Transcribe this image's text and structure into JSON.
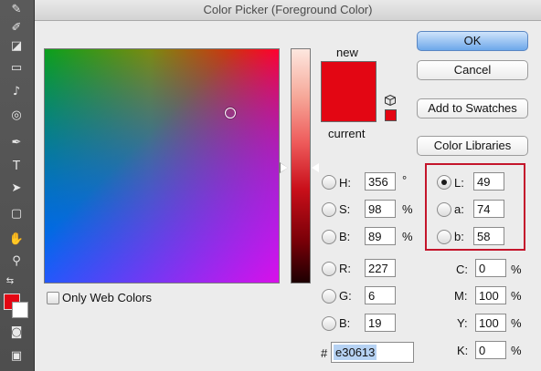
{
  "window": {
    "title": "Color Picker (Foreground Color)"
  },
  "buttons": {
    "ok": "OK",
    "cancel": "Cancel",
    "add_to_swatches": "Add to Swatches",
    "color_libraries": "Color Libraries"
  },
  "preview": {
    "new_label": "new",
    "current_label": "current",
    "new_color": "#e30613",
    "current_color": "#e30613"
  },
  "hsb": {
    "h": {
      "label": "H:",
      "value": "356",
      "unit": "°"
    },
    "s": {
      "label": "S:",
      "value": "98",
      "unit": "%"
    },
    "b": {
      "label": "B:",
      "value": "89",
      "unit": "%"
    }
  },
  "rgb": {
    "r": {
      "label": "R:",
      "value": "227"
    },
    "g": {
      "label": "G:",
      "value": "6"
    },
    "b": {
      "label": "B:",
      "value": "19"
    }
  },
  "lab": {
    "l": {
      "label": "L:",
      "value": "49",
      "selected": true
    },
    "a": {
      "label": "a:",
      "value": "74"
    },
    "b": {
      "label": "b:",
      "value": "58"
    }
  },
  "cmyk": {
    "c": {
      "label": "C:",
      "value": "0",
      "unit": "%"
    },
    "m": {
      "label": "M:",
      "value": "100",
      "unit": "%"
    },
    "y": {
      "label": "Y:",
      "value": "100",
      "unit": "%"
    },
    "k": {
      "label": "K:",
      "value": "0",
      "unit": "%"
    }
  },
  "hex": {
    "symbol": "#",
    "value": "e30613"
  },
  "only_web_colors": {
    "label": "Only Web Colors",
    "checked": false
  },
  "colors": {
    "accent_highlight": "#c4152b",
    "default_button": "#6da7ea"
  }
}
